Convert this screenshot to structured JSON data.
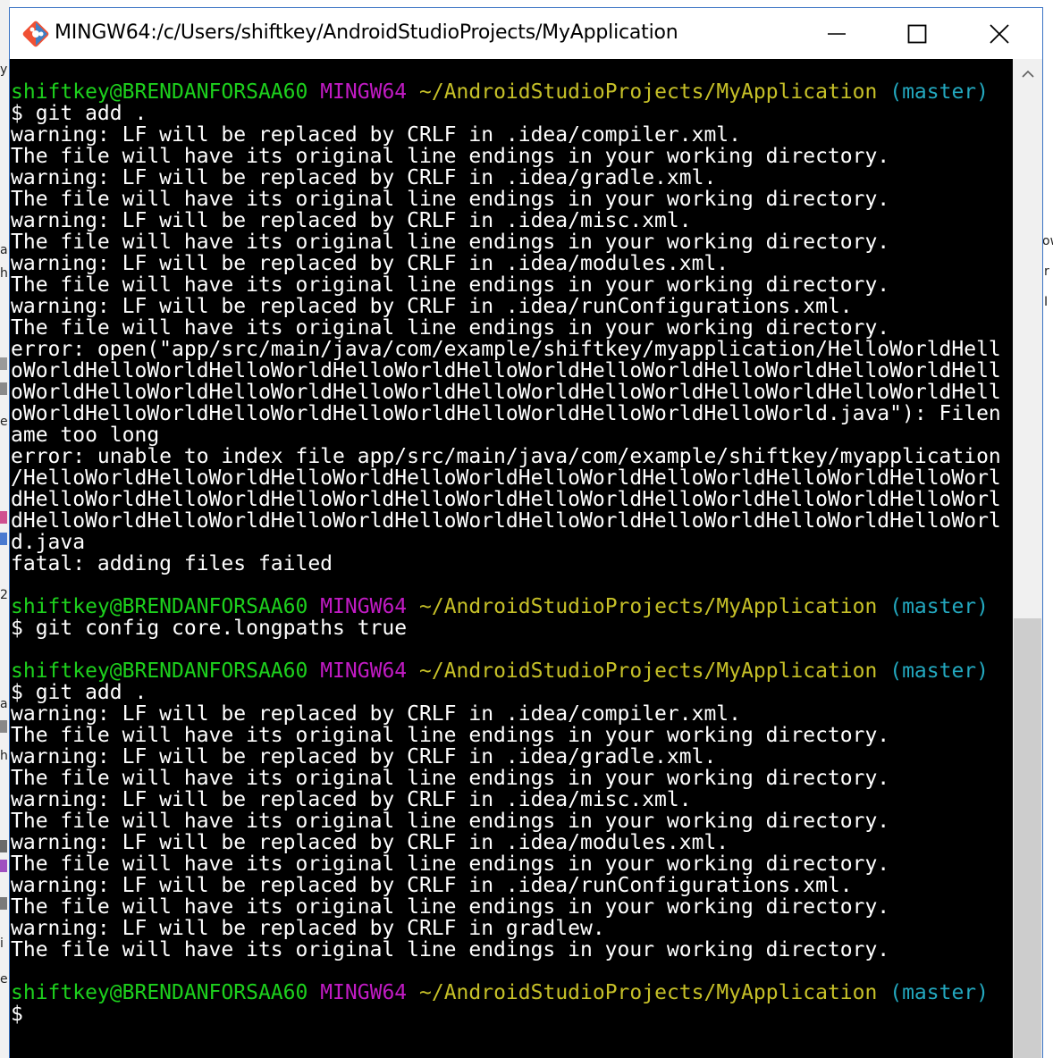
{
  "window": {
    "title": "MINGW64:/c/Users/shiftkey/AndroidStudioProjects/MyApplication",
    "icon": "git-bash-icon"
  },
  "controls": {
    "minimize": "minimize-icon",
    "maximize": "maximize-icon",
    "close": "close-icon"
  },
  "prompt": {
    "user": "shiftkey@BRENDANFORSAA60",
    "msystem": "MINGW64",
    "path": "~/AndroidStudioProjects/MyApplication",
    "branch": "(master)"
  },
  "colors": {
    "user": "#1dd11d",
    "msystem": "#c11bc4",
    "path": "#c6c028",
    "branch": "#23a8bf",
    "text": "#ffffff",
    "background": "#000000"
  },
  "terminal_lines": [
    {
      "kind": "prompt"
    },
    {
      "kind": "text",
      "text": "$ git add ."
    },
    {
      "kind": "text",
      "text": "warning: LF will be replaced by CRLF in .idea/compiler.xml."
    },
    {
      "kind": "text",
      "text": "The file will have its original line endings in your working directory."
    },
    {
      "kind": "text",
      "text": "warning: LF will be replaced by CRLF in .idea/gradle.xml."
    },
    {
      "kind": "text",
      "text": "The file will have its original line endings in your working directory."
    },
    {
      "kind": "text",
      "text": "warning: LF will be replaced by CRLF in .idea/misc.xml."
    },
    {
      "kind": "text",
      "text": "The file will have its original line endings in your working directory."
    },
    {
      "kind": "text",
      "text": "warning: LF will be replaced by CRLF in .idea/modules.xml."
    },
    {
      "kind": "text",
      "text": "The file will have its original line endings in your working directory."
    },
    {
      "kind": "text",
      "text": "warning: LF will be replaced by CRLF in .idea/runConfigurations.xml."
    },
    {
      "kind": "text",
      "text": "The file will have its original line endings in your working directory."
    },
    {
      "kind": "text",
      "text": "error: open(\"app/src/main/java/com/example/shiftkey/myapplication/HelloWorldHell"
    },
    {
      "kind": "text",
      "text": "oWorldHelloWorldHelloWorldHelloWorldHelloWorldHelloWorldHelloWorldHelloWorldHell"
    },
    {
      "kind": "text",
      "text": "oWorldHelloWorldHelloWorldHelloWorldHelloWorldHelloWorldHelloWorldHelloWorldHell"
    },
    {
      "kind": "text",
      "text": "oWorldHelloWorldHelloWorldHelloWorldHelloWorldHelloWorldHelloWorld.java\"): Filen"
    },
    {
      "kind": "text",
      "text": "ame too long"
    },
    {
      "kind": "text",
      "text": "error: unable to index file app/src/main/java/com/example/shiftkey/myapplication"
    },
    {
      "kind": "text",
      "text": "/HelloWorldHelloWorldHelloWorldHelloWorldHelloWorldHelloWorldHelloWorldHelloWorl"
    },
    {
      "kind": "text",
      "text": "dHelloWorldHelloWorldHelloWorldHelloWorldHelloWorldHelloWorldHelloWorldHelloWorl"
    },
    {
      "kind": "text",
      "text": "dHelloWorldHelloWorldHelloWorldHelloWorldHelloWorldHelloWorldHelloWorldHelloWorl"
    },
    {
      "kind": "text",
      "text": "d.java"
    },
    {
      "kind": "text",
      "text": "fatal: adding files failed"
    },
    {
      "kind": "text",
      "text": ""
    },
    {
      "kind": "prompt"
    },
    {
      "kind": "text",
      "text": "$ git config core.longpaths true"
    },
    {
      "kind": "text",
      "text": ""
    },
    {
      "kind": "prompt"
    },
    {
      "kind": "text",
      "text": "$ git add ."
    },
    {
      "kind": "text",
      "text": "warning: LF will be replaced by CRLF in .idea/compiler.xml."
    },
    {
      "kind": "text",
      "text": "The file will have its original line endings in your working directory."
    },
    {
      "kind": "text",
      "text": "warning: LF will be replaced by CRLF in .idea/gradle.xml."
    },
    {
      "kind": "text",
      "text": "The file will have its original line endings in your working directory."
    },
    {
      "kind": "text",
      "text": "warning: LF will be replaced by CRLF in .idea/misc.xml."
    },
    {
      "kind": "text",
      "text": "The file will have its original line endings in your working directory."
    },
    {
      "kind": "text",
      "text": "warning: LF will be replaced by CRLF in .idea/modules.xml."
    },
    {
      "kind": "text",
      "text": "The file will have its original line endings in your working directory."
    },
    {
      "kind": "text",
      "text": "warning: LF will be replaced by CRLF in .idea/runConfigurations.xml."
    },
    {
      "kind": "text",
      "text": "The file will have its original line endings in your working directory."
    },
    {
      "kind": "text",
      "text": "warning: LF will be replaced by CRLF in gradlew."
    },
    {
      "kind": "text",
      "text": "The file will have its original line endings in your working directory."
    },
    {
      "kind": "text",
      "text": ""
    },
    {
      "kind": "prompt"
    },
    {
      "kind": "text",
      "text": "$"
    }
  ],
  "background": {
    "fragments": [
      {
        "text": "y"
      },
      {
        "text": "a"
      },
      {
        "text": "h"
      },
      {
        "text": "e"
      },
      {
        "text": "2"
      },
      {
        "text": "a"
      },
      {
        "text": "h"
      },
      {
        "text": "i"
      },
      {
        "text": "e"
      },
      {
        "text": "ow"
      },
      {
        "text": "r"
      },
      {
        "text": "I"
      }
    ]
  }
}
